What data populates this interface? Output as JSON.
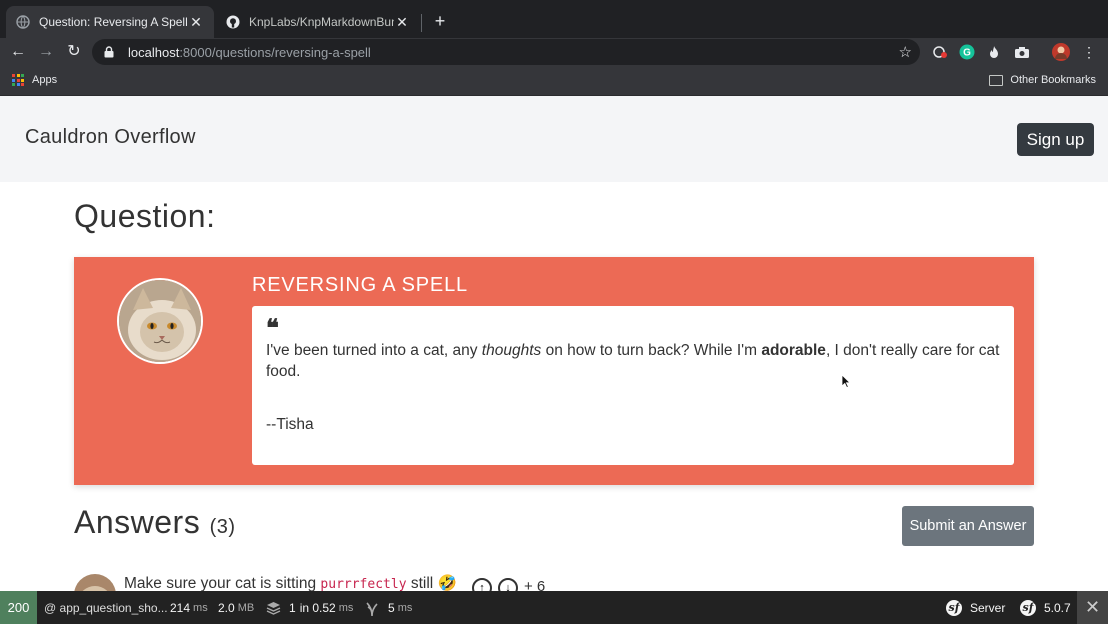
{
  "browser": {
    "tabs": [
      {
        "title": "Question: Reversing A Spell",
        "icon": "globe-icon",
        "active": true
      },
      {
        "title": "KnpLabs/KnpMarkdownBundle: ",
        "icon": "github-icon",
        "active": false
      }
    ],
    "new_tab_label": "+",
    "url_host": "localhost",
    "url_path": ":8000/questions/reversing-a-spell",
    "bookmarks": {
      "apps_label": "Apps",
      "other_label": "Other Bookmarks"
    }
  },
  "site": {
    "brand": "Cauldron Overflow",
    "signup_label": "Sign up"
  },
  "question": {
    "heading": "Question:",
    "title": "REVERSING A SPELL",
    "text_part1": "I've been turned into a cat, any ",
    "text_em": "thoughts",
    "text_part2": " on how to turn back? While I'm ",
    "text_strong": "adorable",
    "text_part3": ", I don't really care for cat food.",
    "author": "--Tisha"
  },
  "answers": {
    "heading": "Answers",
    "count": "(3)",
    "submit_label": "Submit an Answer",
    "first": {
      "text_before": "Make sure your cat is sitting ",
      "code": "purrrfectly",
      "text_after": " still 🤣",
      "votes": "+ 6"
    }
  },
  "profiler": {
    "status": "200",
    "route": "@ app_question_sho...",
    "time_value": "214",
    "time_unit": "ms",
    "memory_value": "2.0",
    "memory_unit": "MB",
    "db_value": "1",
    "db_in": "in 0.52",
    "db_unit": "ms",
    "twig_value": "5",
    "twig_unit": "ms",
    "server_label": "Server",
    "version": "5.0.7"
  },
  "colors": {
    "card": "#ec6a55",
    "status_ok": "#4f805d"
  }
}
